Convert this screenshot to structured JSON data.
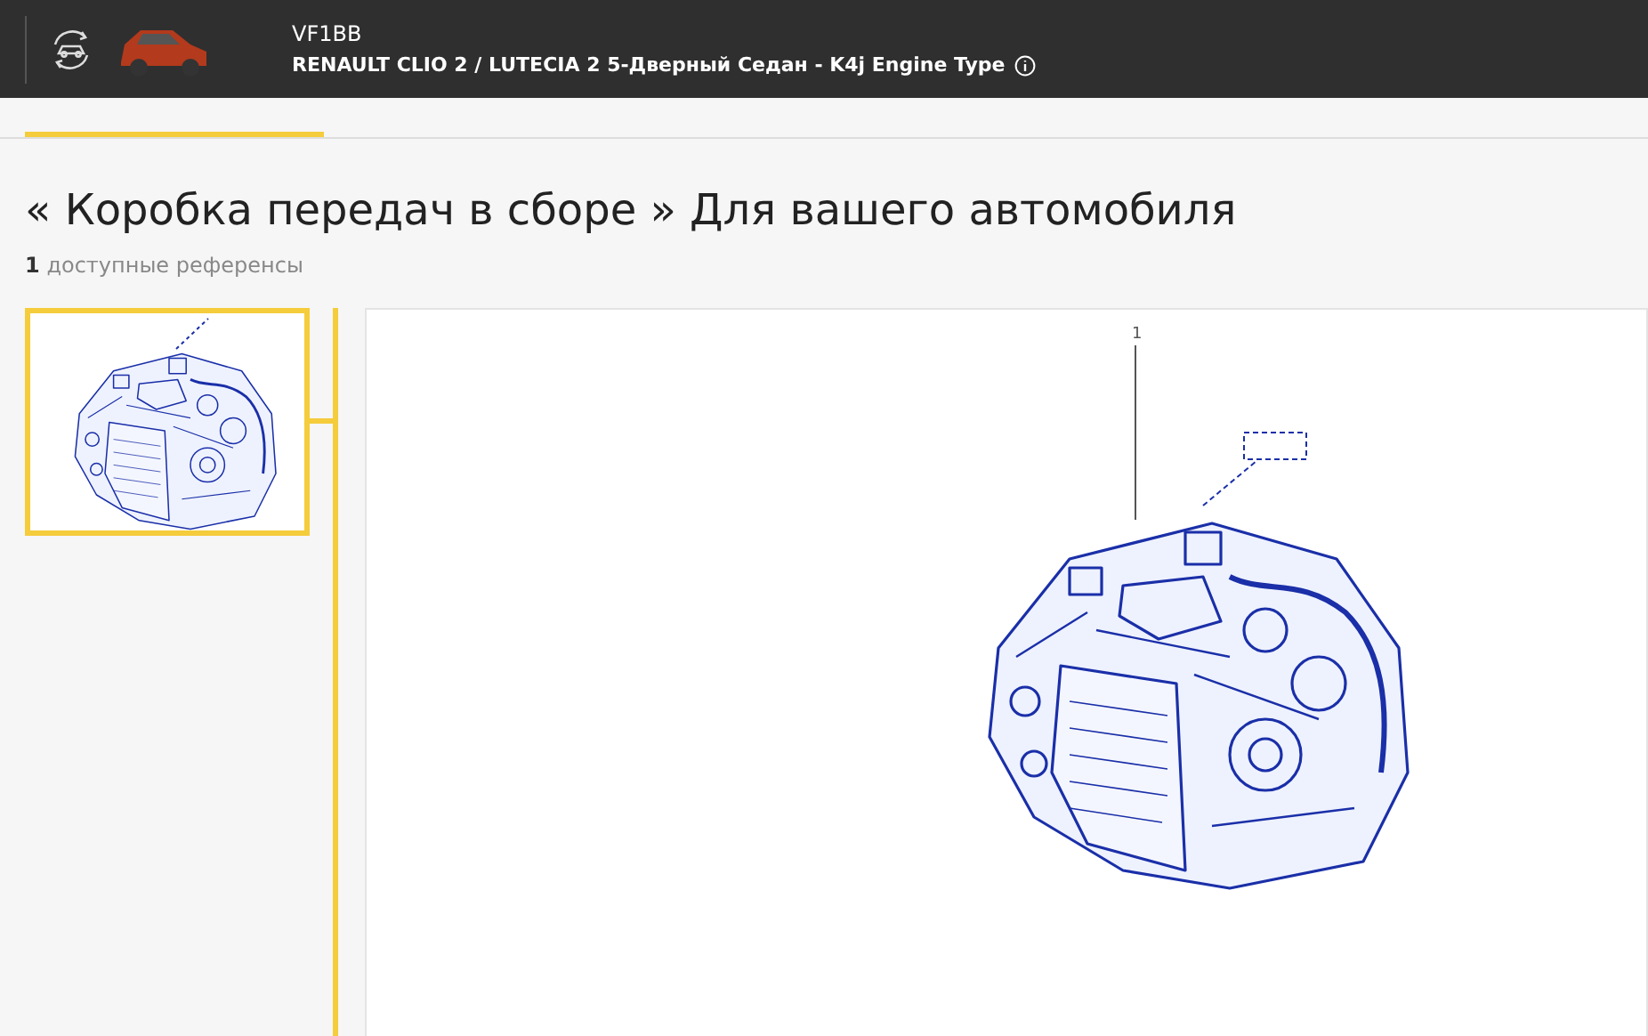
{
  "header": {
    "vin": "VF1BB",
    "vehicle": "RENAULT CLIO 2 / LUTECIA 2 5-Дверный Седан - K4j Engine Type"
  },
  "title": "« Коробка передач в сборе » Для вашего автомобиля",
  "references": {
    "count": "1",
    "label": "доступные референсы"
  },
  "thumbnails": [
    {
      "selected": true
    }
  ],
  "diagram": {
    "callouts": [
      {
        "label": "1"
      }
    ]
  }
}
